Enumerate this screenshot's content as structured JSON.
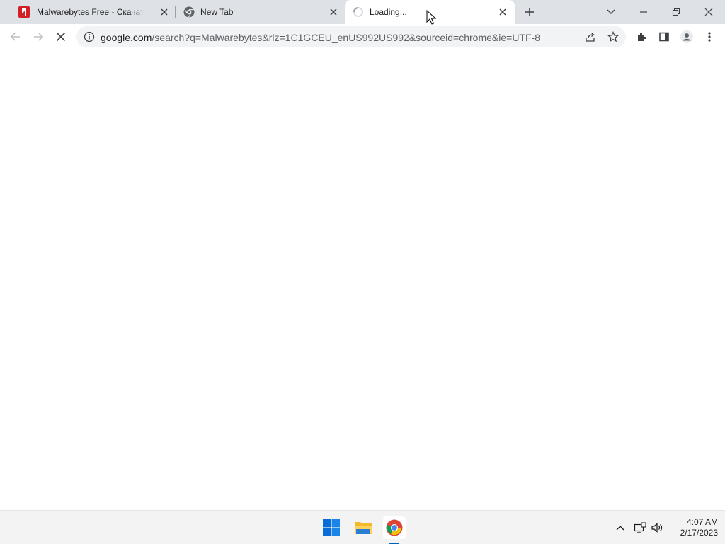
{
  "tabs": [
    {
      "title": "Malwarebytes Free - Скачать бесплатно",
      "favicon": "malwarebytes-favicon"
    },
    {
      "title": "New Tab",
      "favicon": "chrome-favicon"
    },
    {
      "title": "Loading...",
      "favicon": "loading-spinner-icon",
      "active": true
    }
  ],
  "window_controls": {
    "tab_search": "chevron-down-icon",
    "minimize": "minimize-icon",
    "restore": "restore-icon",
    "close": "close-icon"
  },
  "toolbar": {
    "url_host": "google.com",
    "url_rest": "/search?q=Malwarebytes&rlz=1C1GCEU_enUS992US992&sourceid=chrome&ie=UTF-8"
  },
  "taskbar": {
    "time": "4:07 AM",
    "date": "2/17/2023"
  },
  "colors": {
    "tabstrip_bg": "#dee1e6",
    "omnibox_bg": "#f1f3f4",
    "taskbar_bg": "#f3f3f3",
    "accent": "#005fb8"
  }
}
